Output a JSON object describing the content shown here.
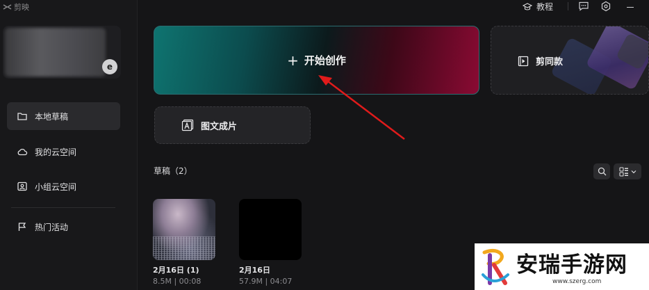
{
  "app": {
    "logo_text": "剪映"
  },
  "topbar": {
    "tutorial_label": "教程"
  },
  "sidebar": {
    "avatar_letter": "e",
    "items": [
      {
        "label": "本地草稿",
        "icon": "folder-icon",
        "active": true
      },
      {
        "label": "我的云空间",
        "icon": "cloud-icon",
        "active": false
      },
      {
        "label": "小组云空间",
        "icon": "group-cloud-icon",
        "active": false
      },
      {
        "label": "热门活动",
        "icon": "flag-icon",
        "active": false
      }
    ]
  },
  "main": {
    "start_button_label": "开始创作",
    "template_button_label": "剪同款",
    "image_text_button_label": "图文成片",
    "drafts_title": "草稿（2）",
    "drafts": [
      {
        "name": "2月16日 (1)",
        "meta": "8.5M | 00:08",
        "thumb": "photo"
      },
      {
        "name": "2月16日",
        "meta": "57.9M | 04:07",
        "thumb": "black"
      }
    ]
  },
  "watermark": {
    "title": "安瑞手游网",
    "url": "www.szerg.com"
  },
  "colors": {
    "accent_teal": "#0e7470",
    "accent_red": "#8a0a33",
    "arrow": "#e01b1b",
    "background": "#151517"
  }
}
